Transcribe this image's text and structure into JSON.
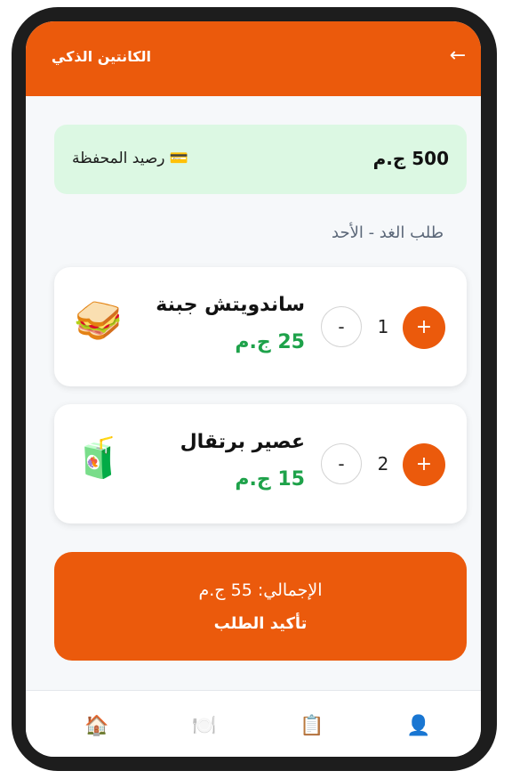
{
  "header": {
    "title": "الكانتين الذكي",
    "back_icon": "←"
  },
  "wallet": {
    "icon": "💳",
    "label": "رصيد المحفظة",
    "balance": "500 ج.م",
    "background_color": "#dcf8e3"
  },
  "order": {
    "title": "طلب الغد - الأحد",
    "items": [
      {
        "name": "ساندويتش جبنة",
        "price": "25 ج.م",
        "quantity": "1",
        "icon": "🥪",
        "minus_label": "-",
        "plus_label": "+"
      },
      {
        "name": "عصير برتقال",
        "price": "15 ج.م",
        "quantity": "2",
        "icon": "🧃",
        "minus_label": "-",
        "plus_label": "+"
      }
    ]
  },
  "confirm": {
    "total": "الإجمالي: 55 ج.م",
    "label": "تأكيد الطلب"
  },
  "bottom_nav": {
    "items": [
      {
        "icon": "🏠",
        "name": "home-icon"
      },
      {
        "icon": "🍽️",
        "name": "plate-icon"
      },
      {
        "icon": "📋",
        "name": "clipboard-icon"
      },
      {
        "icon": "👤",
        "name": "profile-icon"
      }
    ]
  },
  "colors": {
    "accent": "#eb5a0c",
    "price_green": "#1ea24a",
    "wallet_bg": "#dcf8e3",
    "page_bg": "#f6f8fa"
  }
}
